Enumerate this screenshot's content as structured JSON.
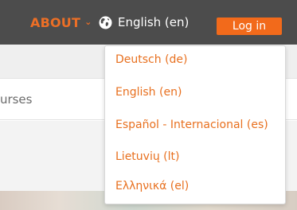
{
  "header": {
    "about_label": "ABOUT",
    "about_icon": "chevron-down-icon",
    "language_icon": "globe-icon",
    "current_language": "English (en)",
    "login_label": "Log in"
  },
  "search": {
    "placeholder": "ch courses"
  },
  "language_menu": {
    "items": [
      "Deutsch (de)",
      "English (en)",
      "Español - Internacional (es)",
      "Lietuvių (lt)",
      "Ελληνικά (el)"
    ]
  },
  "colors": {
    "header_bg": "#4c4c4c",
    "accent": "#ec6f26",
    "login_bg": "#f26a1b",
    "menu_text": "#e8701f"
  }
}
